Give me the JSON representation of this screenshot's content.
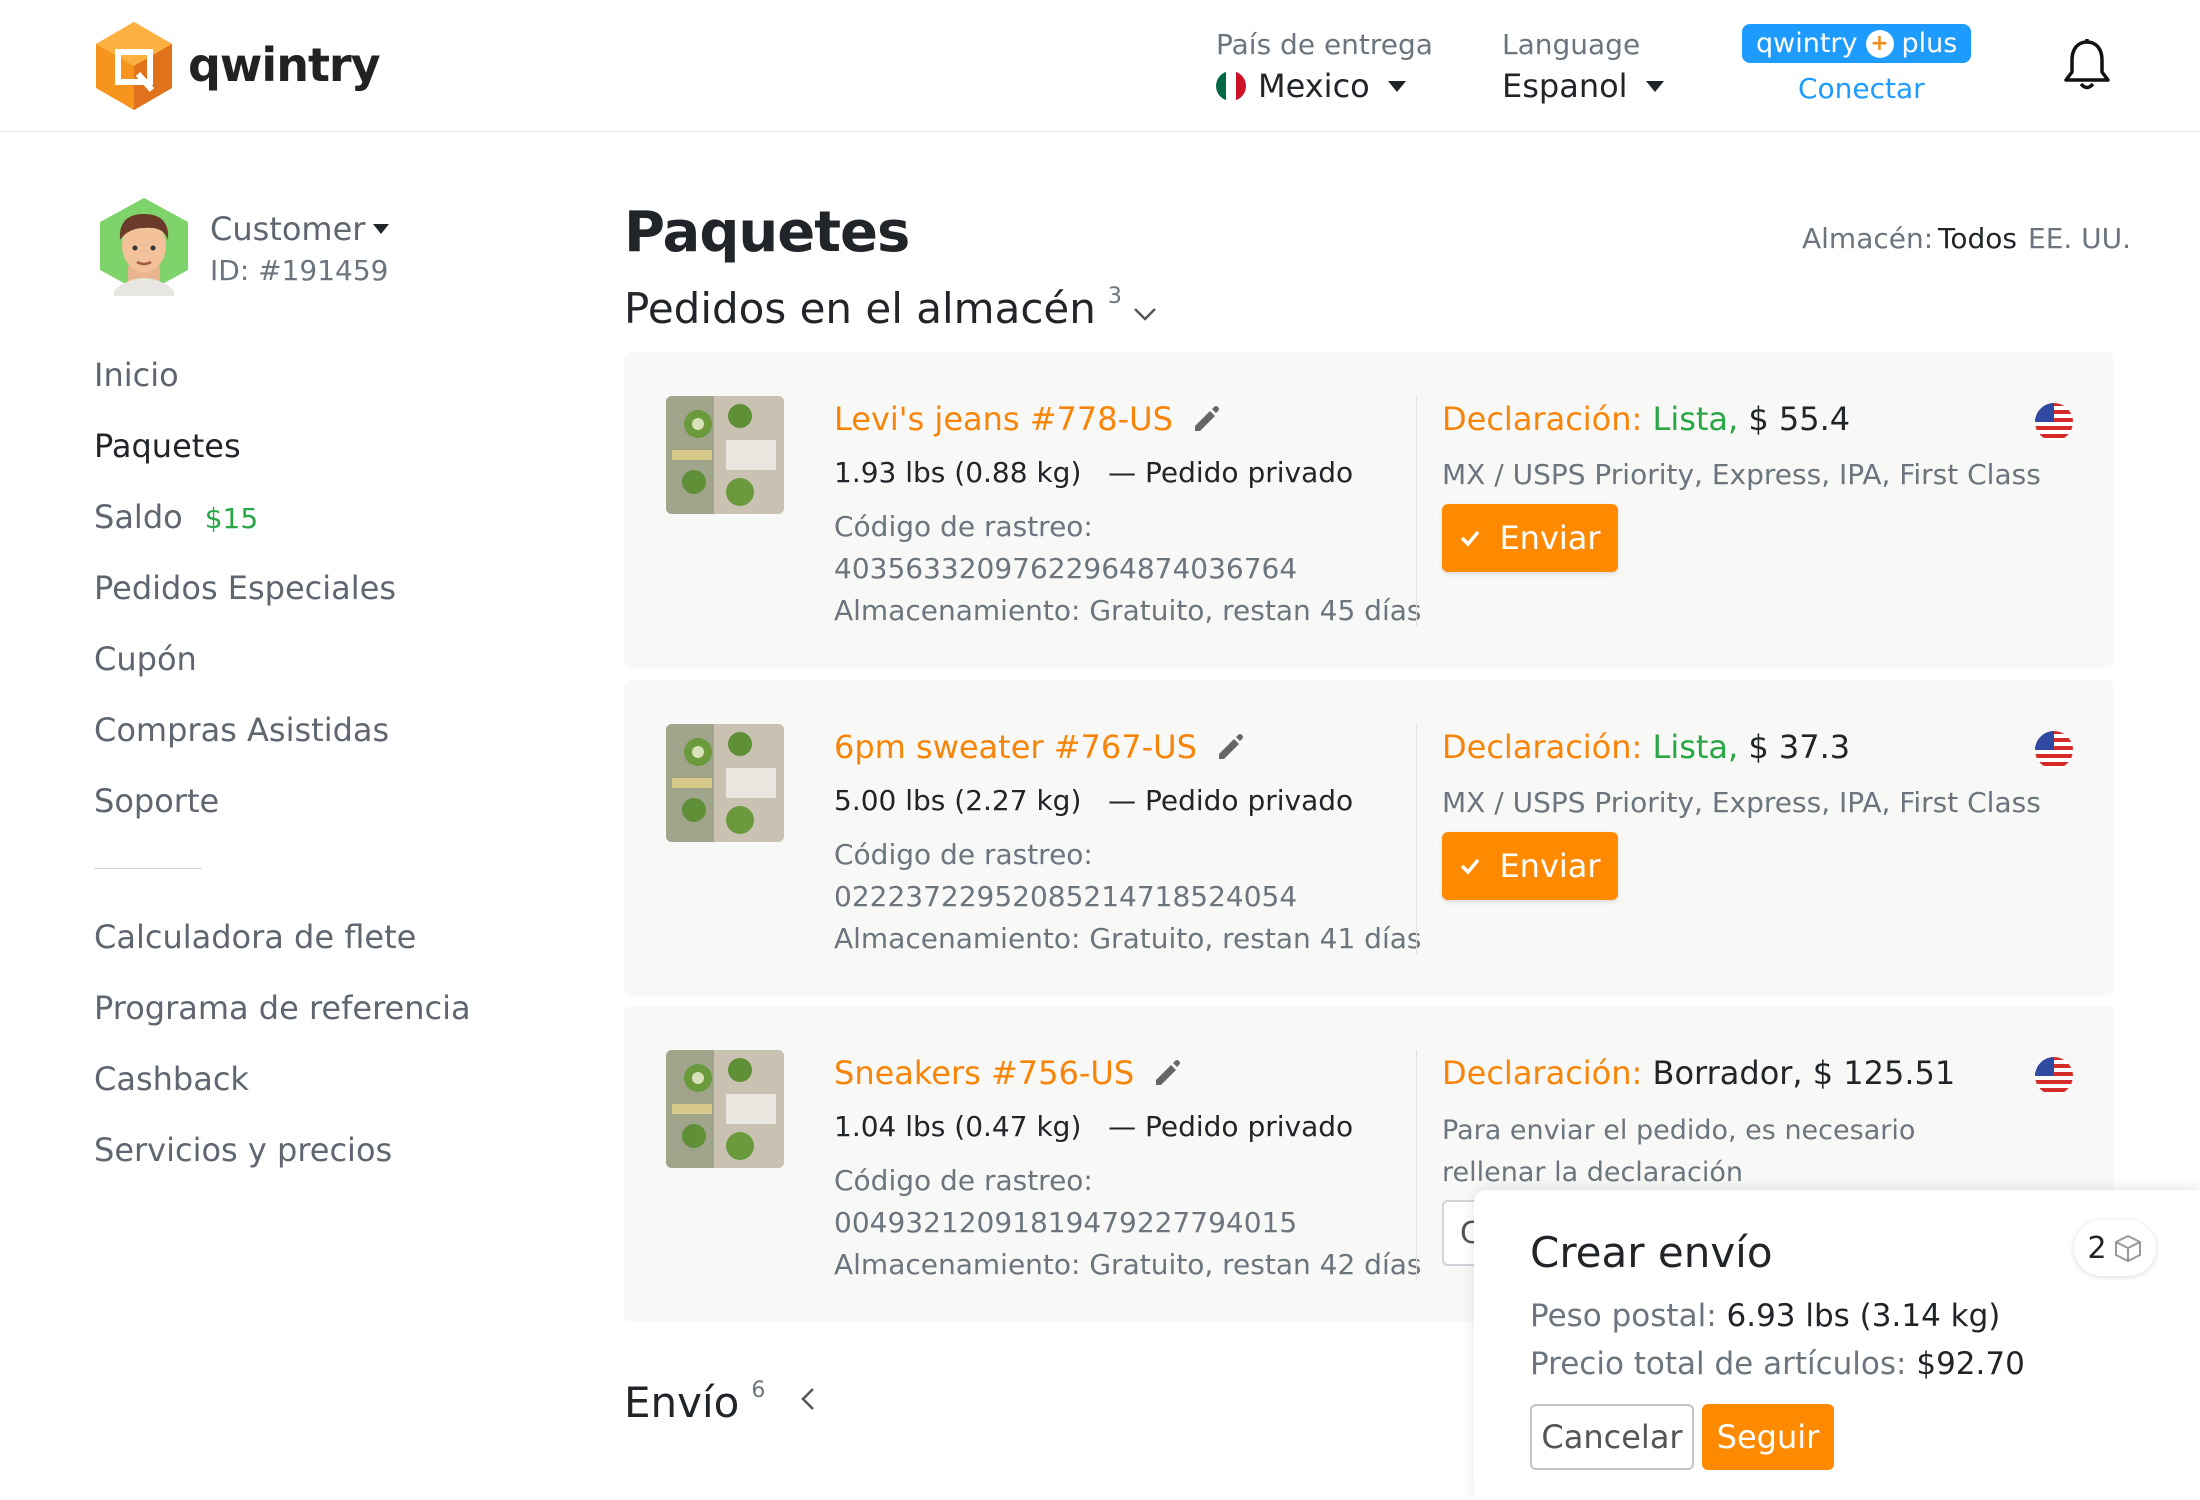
{
  "brand": {
    "name": "qwintry"
  },
  "header": {
    "delivery_label": "País de entrega",
    "delivery_value": "Mexico",
    "language_label": "Language",
    "language_value": "Espanol",
    "plus_left": "qwintry",
    "plus_right": "plus",
    "connect_label": "Conectar",
    "bell_icon": "bell-icon"
  },
  "user": {
    "name": "Customer",
    "id": "ID: #191459"
  },
  "sidebar": {
    "items": [
      {
        "label": "Inicio"
      },
      {
        "label": "Paquetes"
      },
      {
        "label": "Saldo",
        "badge": "$15"
      },
      {
        "label": "Pedidos Especiales"
      },
      {
        "label": "Cupón"
      },
      {
        "label": "Compras Asistidas"
      },
      {
        "label": "Soporte"
      }
    ],
    "secondary": [
      {
        "label": "Calculadora de flete"
      },
      {
        "label": "Programa de referencia"
      },
      {
        "label": "Cashback"
      },
      {
        "label": "Servicios y precios"
      }
    ]
  },
  "main": {
    "title": "Paquetes",
    "warehouse_label": "Almacén:",
    "warehouse_all": "Todos",
    "warehouse_us": "EE. UU.",
    "section_warehouse": {
      "title": "Pedidos en el almacén",
      "count": "3"
    },
    "section_shipping": {
      "title": "Envío",
      "count": "6"
    }
  },
  "packages": [
    {
      "title": "Levi's jeans #778-US",
      "weight": "1.93 lbs (0.88 kg)",
      "type": "— Pedido privado",
      "tracking_label": "Código de rastreo:",
      "tracking": "4035633209762296487403676​4",
      "storage": "Almacenamiento: Gratuito, restan 45 días",
      "decl_label": "Declaración:",
      "decl_status": "Lista,",
      "decl_value": "$ 55.4",
      "methods": "MX / USPS Priority, Express, IPA, First Class",
      "send_label": "Enviar"
    },
    {
      "title": "6pm sweater #767-US",
      "weight": "5.00 lbs (2.27 kg)",
      "type": "— Pedido privado",
      "tracking_label": "Código de rastreo:",
      "tracking": "022237229520852147185240​54",
      "storage": "Almacenamiento: Gratuito, restan 41 días",
      "decl_label": "Declaración:",
      "decl_status": "Lista,",
      "decl_value": "$ 37.3",
      "methods": "MX / USPS Priority, Express, IPA, First Class",
      "send_label": "Enviar"
    },
    {
      "title": "Sneakers #756-US",
      "weight": "1.04 lbs (0.47 kg)",
      "type": "— Pedido privado",
      "tracking_label": "Código de rastreo:",
      "tracking": "004932120918194792277940​15",
      "storage": "Almacenamiento: Gratuito, restan 42 días",
      "decl_label": "Declaración:",
      "decl_status": "Borrador,",
      "decl_value": "$ 125.51",
      "note": "Para enviar el pedido, es necesario rellenar la declaración",
      "stub": "C"
    }
  ],
  "popup": {
    "title": "Crear envío",
    "count": "2",
    "weight_label": "Peso postal:",
    "weight_value": "6.93 lbs (3.14 kg)",
    "price_label": "Precio total de artículos:",
    "price_value": "$92.70",
    "cancel": "Cancelar",
    "next": "Seguir"
  },
  "colors": {
    "accent": "#ff8a00",
    "link_orange": "#f7850a",
    "green": "#28a745",
    "blue": "#1e9bff"
  }
}
